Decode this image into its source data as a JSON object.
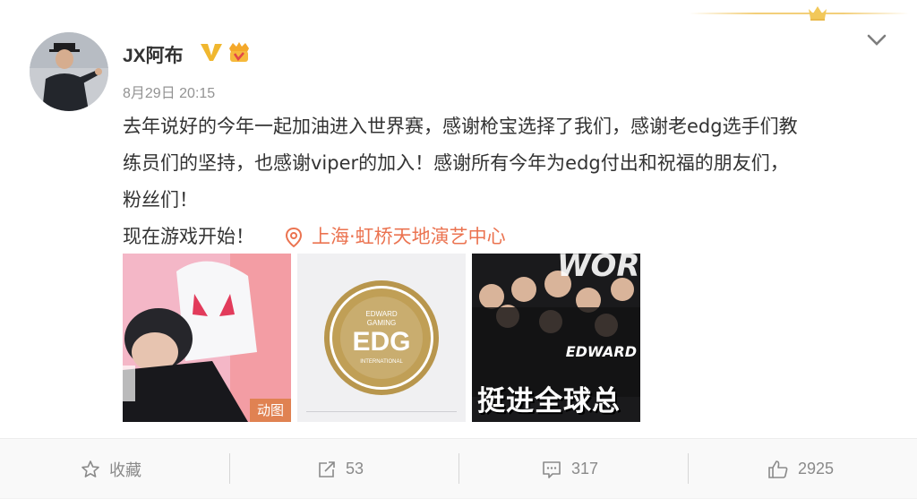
{
  "post": {
    "username": "JX阿布",
    "timestamp": "8月29日 20:15",
    "body_line1": "去年说好的今年一起加油进入世界赛，感谢枪宝选择了我们，感谢老edg选手们教",
    "body_line2": "练员们的坚持，也感谢viper的加入！感谢所有今年为edg付出和祝福的朋友们，",
    "body_line3": "粉丝们！",
    "body_line4": "现在游戏开始！",
    "location": "上海·虹桥天地演艺中心"
  },
  "images": {
    "gif_badge": "动图",
    "edg_logo_top": "EDWARD",
    "edg_logo_sub": "GAMING",
    "edg_logo_main": "EDG",
    "edg_logo_bottom": "INTERNATIONAL",
    "thumb3_world": "WORLD",
    "thumb3_edward": "EDWARD",
    "thumb3_caption": "挺进全球总"
  },
  "actions": {
    "favorite_label": "收藏",
    "share_count": "53",
    "comment_count": "317",
    "like_count": "2925"
  },
  "colors": {
    "location": "#eb7350",
    "gold": "#f3cf7a",
    "text": "#333333",
    "muted": "#939393"
  },
  "icons": [
    "crown-icon",
    "chevron-down-icon",
    "verified-icon",
    "member-icon",
    "location-pin-icon",
    "star-icon",
    "share-icon",
    "comment-icon",
    "like-icon"
  ]
}
